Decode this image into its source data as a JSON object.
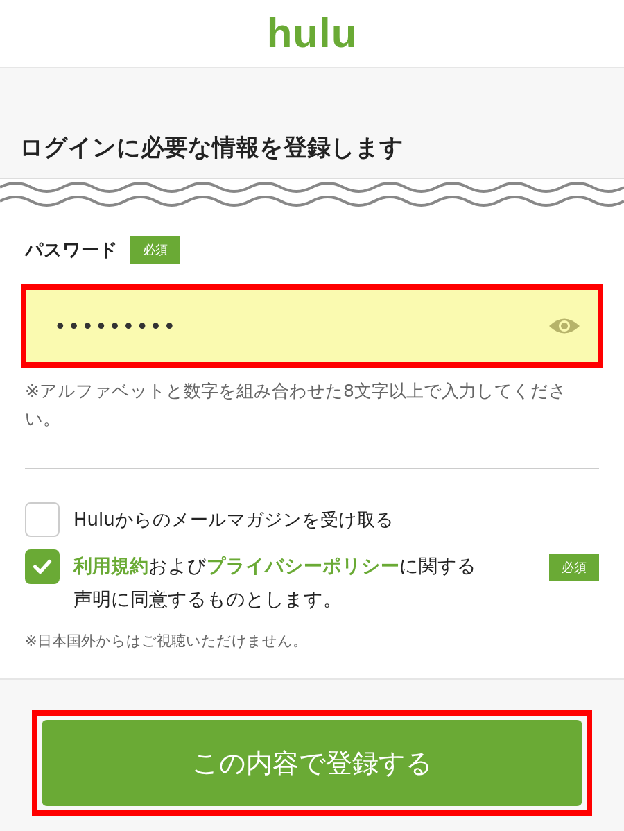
{
  "header": {
    "logo": "hulu"
  },
  "heading": "ログインに必要な情報を登録します",
  "password": {
    "label": "パスワード",
    "badge": "必須",
    "value": "•••••••••",
    "highlighted": true,
    "hint": "※アルファベットと数字を組み合わせた8文字以上で入力してください。"
  },
  "options": [
    {
      "kind": "plain",
      "checked": false,
      "text": "Huluからのメールマガジンを受け取る"
    },
    {
      "kind": "consent",
      "checked": true,
      "badge": "必須",
      "segments": [
        {
          "kind": "link",
          "text": "利用規約"
        },
        {
          "kind": "text",
          "text": "および"
        },
        {
          "kind": "link",
          "text": "プライバシーポリシー"
        },
        {
          "kind": "text",
          "text": "に関する声明に同意するものとします。"
        }
      ]
    }
  ],
  "note": "※日本国外からはご視聴いただけません。",
  "submit": {
    "label": "この内容で登録する",
    "highlighted": true
  }
}
